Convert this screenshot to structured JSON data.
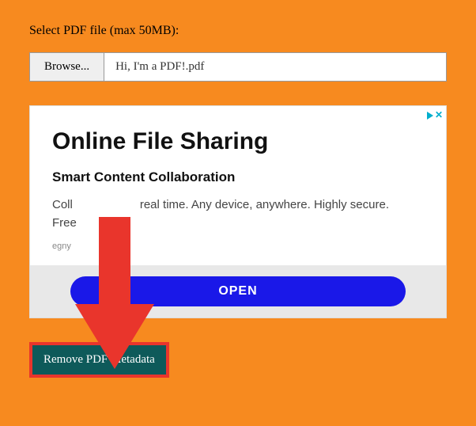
{
  "fileInput": {
    "label": "Select PDF file (max 50MB):",
    "browseLabel": "Browse...",
    "filename": "Hi, I'm a PDF!.pdf"
  },
  "ad": {
    "headline": "Online File Sharing",
    "subhead": "Smart Content Collaboration",
    "bodyLine1": "Coll",
    "bodyLine1b": "real time. Any device, anywhere. Highly secure.",
    "bodyLine2": "Free",
    "source": "egny",
    "ctaLabel": "OPEN",
    "closeLabel": "✕"
  },
  "action": {
    "buttonLabel": "Remove PDF Metadata"
  }
}
